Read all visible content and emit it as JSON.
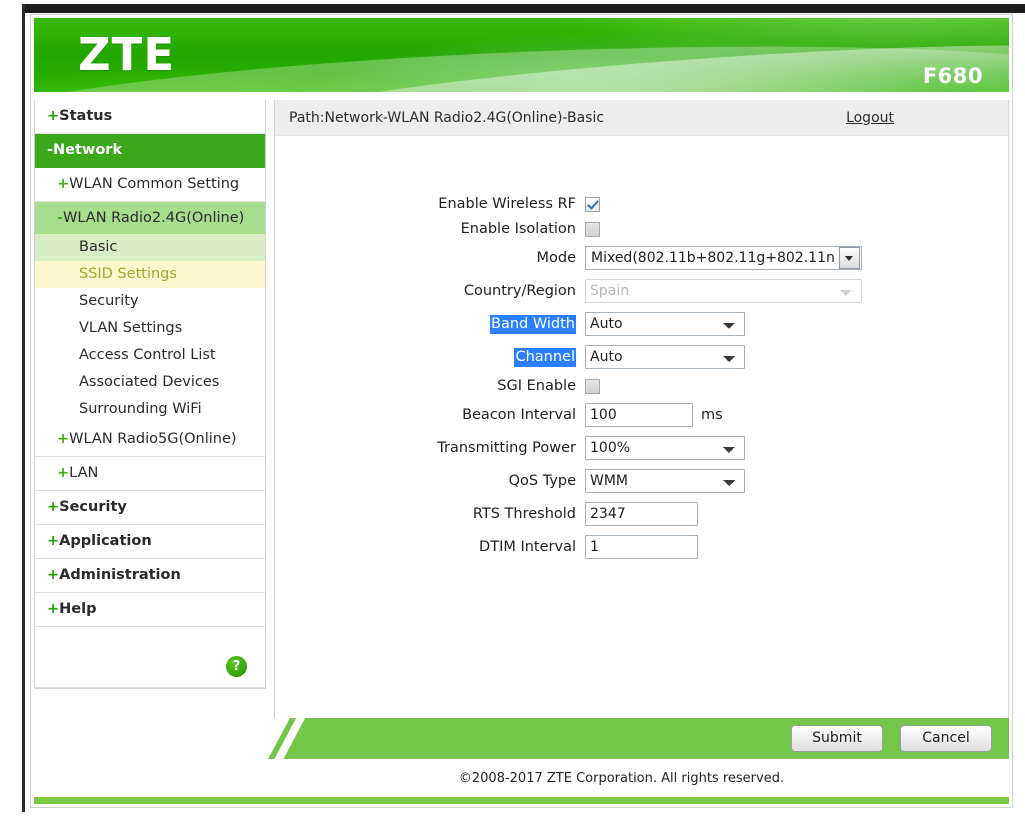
{
  "header": {
    "logo": "ZTE",
    "model": "F680"
  },
  "pathbar": {
    "path": "Path:Network-WLAN Radio2.4G(Online)-Basic",
    "logout": "Logout"
  },
  "sidebar": {
    "items": [
      {
        "sign": "+",
        "label": "Status"
      },
      {
        "sign": "-",
        "label": "Network"
      },
      {
        "sign": "+",
        "label": "WLAN Common Setting"
      },
      {
        "sign": "-",
        "label": "WLAN Radio2.4G(Online)"
      },
      {
        "sign": "",
        "label": "Basic"
      },
      {
        "sign": "",
        "label": "SSID Settings"
      },
      {
        "sign": "",
        "label": "Security"
      },
      {
        "sign": "",
        "label": "VLAN Settings"
      },
      {
        "sign": "",
        "label": "Access Control List"
      },
      {
        "sign": "",
        "label": "Associated Devices"
      },
      {
        "sign": "",
        "label": "Surrounding WiFi"
      },
      {
        "sign": "+",
        "label": "WLAN Radio5G(Online)"
      },
      {
        "sign": "+",
        "label": "LAN"
      },
      {
        "sign": "+",
        "label": "Security"
      },
      {
        "sign": "+",
        "label": "Application"
      },
      {
        "sign": "+",
        "label": "Administration"
      },
      {
        "sign": "+",
        "label": "Help"
      }
    ],
    "help_badge": "?"
  },
  "form": {
    "enable_wireless_rf": {
      "label": "Enable Wireless RF",
      "checked": "true"
    },
    "enable_isolation": {
      "label": "Enable Isolation",
      "checked": "false"
    },
    "mode": {
      "label": "Mode",
      "value": "Mixed(802.11b+802.11g+802.11n"
    },
    "country_region": {
      "label": "Country/Region",
      "value": "Spain"
    },
    "band_width": {
      "label": "Band Width",
      "value": "Auto"
    },
    "channel": {
      "label": "Channel",
      "value": "Auto"
    },
    "sgi_enable": {
      "label": "SGI Enable",
      "checked": "false"
    },
    "beacon_interval": {
      "label": "Beacon Interval",
      "value": "100",
      "unit": "ms"
    },
    "transmitting_power": {
      "label": "Transmitting Power",
      "value": "100%"
    },
    "qos_type": {
      "label": "QoS Type",
      "value": "WMM"
    },
    "rts_threshold": {
      "label": "RTS Threshold",
      "value": "2347"
    },
    "dtim_interval": {
      "label": "DTIM Interval",
      "value": "1"
    }
  },
  "footer": {
    "submit": "Submit",
    "cancel": "Cancel",
    "copyright": "©2008-2017 ZTE Corporation. All rights reserved."
  },
  "colors": {
    "brand_green": "#2db200",
    "nav_active": "#3aa81a",
    "nav_open": "#a8dd8e",
    "nav_sel_green": "#d6edc6",
    "nav_sel_yellow": "#fdf7cd",
    "action_band": "#74c64a",
    "selection_blue": "#2a7fff"
  }
}
